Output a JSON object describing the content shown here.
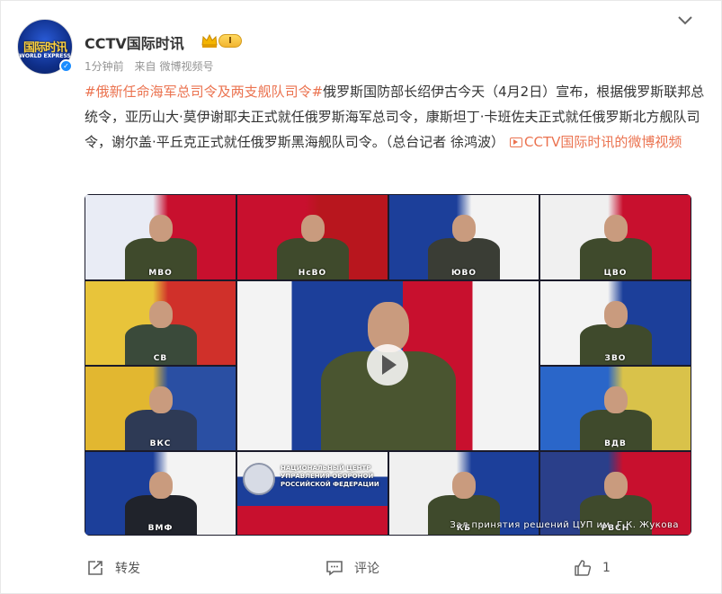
{
  "post": {
    "author": "CCTV国际时讯",
    "level": "I",
    "time": "1分钟前",
    "source_prefix": "来自",
    "source": "微博视频号",
    "hashtag": "#俄新任命海军总司令及两支舰队司令#",
    "text": "俄罗斯国防部长绍伊古今天（4月2日）宣布，根据俄罗斯联邦总统令，亚历山大·莫伊谢耶夫正式就任俄罗斯海军总司令，康斯坦丁·卡班佐夫正式就任俄罗斯北方舰队司令，谢尔盖·平丘克正式就任俄罗斯黑海舰队司令。（总台记者 徐鸿波）",
    "video_link": "CCTV国际时讯的微博视频",
    "avatar_logo": "国际时讯",
    "avatar_sub": "WORLD EXPRESS"
  },
  "video": {
    "caption": "Зал принятия решений ЦУП им. Г.К. Жукова",
    "tiles": [
      {
        "label": "МВО"
      },
      {
        "label": "НсВО"
      },
      {
        "label": "ЮВО"
      },
      {
        "label": "ЦВО"
      },
      {
        "label": "СВ"
      },
      {
        "label": "ЗВО"
      },
      {
        "label": "ВКС"
      },
      {
        "label": "ВДВ"
      },
      {
        "label": "ВМФ"
      },
      {
        "label": "НАЦИОНАЛЬНЫЙ ЦЕНТР УПРАВЛЕНИЯ ОБОРОНОЙ РОССИЙСКОЙ ФЕДЕРАЦИИ"
      },
      {
        "label": "КБ"
      },
      {
        "label": "РВСН"
      }
    ]
  },
  "actions": {
    "repost": "转发",
    "comment": "评论",
    "like_count": "1"
  },
  "colors": {
    "accent": "#eb7350",
    "text": "#333333",
    "muted": "#939393"
  }
}
